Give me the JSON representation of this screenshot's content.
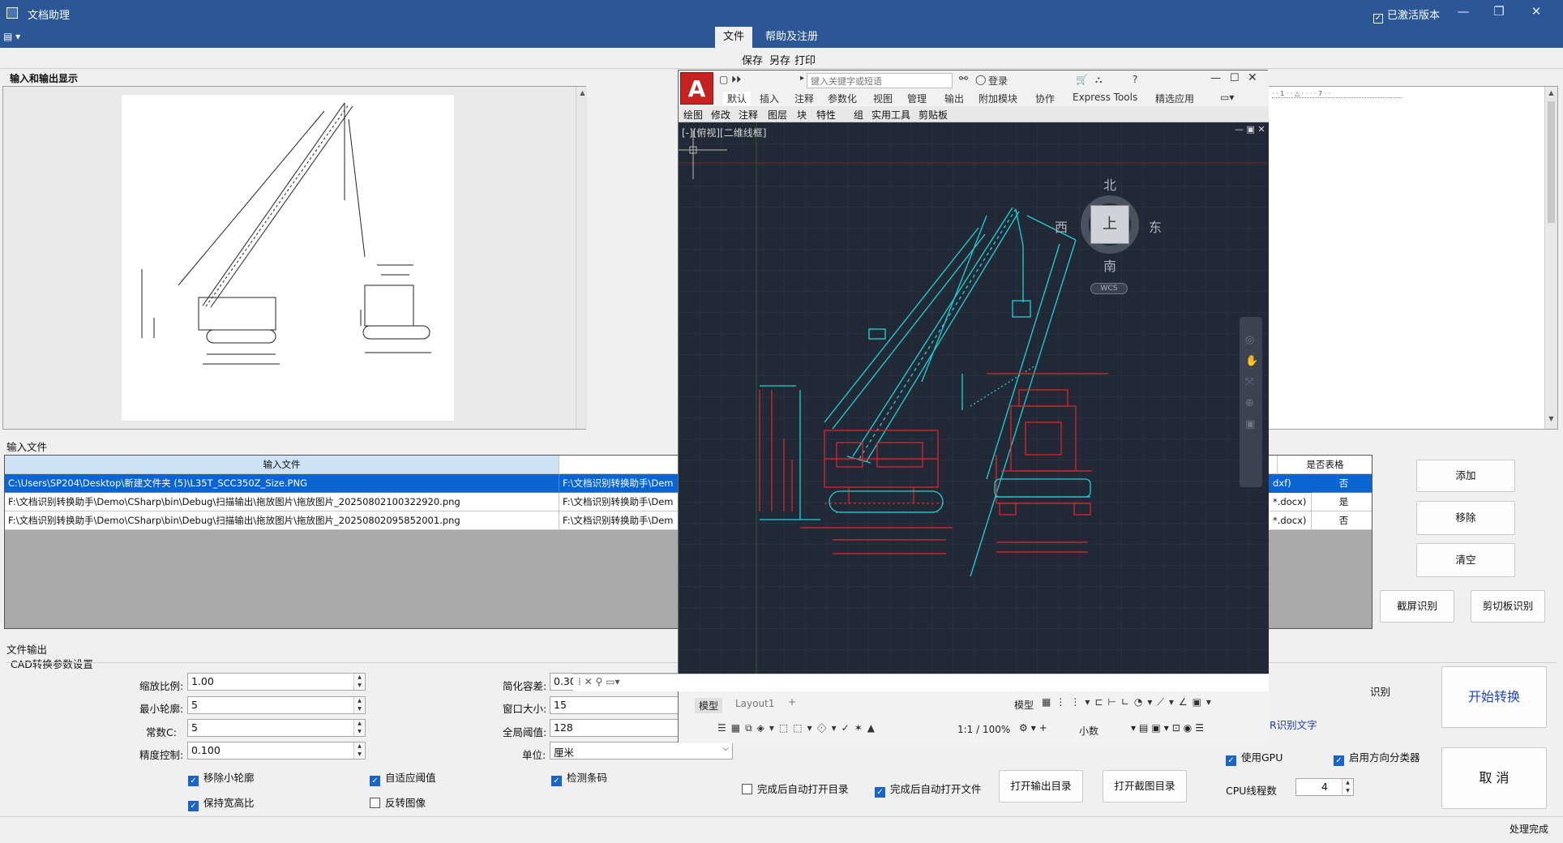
{
  "window": {
    "title": "文档助理",
    "activation": "已激活版本",
    "min": "—",
    "restore": "❐",
    "close": "✕"
  },
  "menu": {
    "tabs": [
      "文件",
      "帮助及注册"
    ],
    "sub_actions": [
      "保存",
      "另存",
      "打印"
    ]
  },
  "io_panel": {
    "title": "输入和输出显示"
  },
  "input_files": {
    "title": "输入文件",
    "columns": [
      "输入文件",
      "",
      "是否表格"
    ],
    "rows": [
      {
        "input": "C:\\Users\\SP204\\Desktop\\新建文件夹 (5)\\L35T_SCC350Z_Size.PNG",
        "output": "F:\\文档识别转换助手\\Dem",
        "ext": "dxf)",
        "is_table": "否"
      },
      {
        "input": "F:\\文档识别转换助手\\Demo\\CSharp\\bin\\Debug\\扫描输出\\拖放图片\\拖放图片_20250802100322920.png",
        "output": "F:\\文档识别转换助手\\Dem",
        "ext": "*.docx)",
        "is_table": "是"
      },
      {
        "input": "F:\\文档识别转换助手\\Demo\\CSharp\\bin\\Debug\\扫描输出\\拖放图片\\拖放图片_20250802095852001.png",
        "output": "F:\\文档识别转换助手\\Dem",
        "ext": "*.docx)",
        "is_table": "否"
      }
    ],
    "buttons": {
      "add": "添加",
      "remove": "移除",
      "clear": "清空",
      "screen_ocr": "截屏识别",
      "clipboard_ocr": "剪切板识别"
    }
  },
  "file_output": {
    "title": "文件输出",
    "cad_group": "CAD转换参数设置",
    "fields": {
      "scale_label": "缩放比例:",
      "scale": "1.00",
      "min_contour_label": "最小轮廓:",
      "min_contour": "5",
      "const_c_label": "常数C:",
      "const_c": "5",
      "precision_label": "精度控制:",
      "precision": "0.100",
      "simplify_label": "简化容差:",
      "simplify": "0.30",
      "window_label": "窗口大小:",
      "window": "15",
      "global_label": "全局阈值:",
      "global": "128",
      "unit_label": "单位:",
      "unit": "厘米"
    },
    "checks": {
      "remove_small": "移除小轮廓",
      "adaptive": "自适应阈值",
      "detect_bars": "检测条码",
      "keep_ratio": "保持宽高比",
      "invert": "反转图像",
      "open_dir_after": "完成后自动打开目录",
      "open_file_after": "完成后自动打开文件",
      "use_gpu": "使用GPU",
      "dir_classifier": "启用方向分类器"
    },
    "buttons": {
      "open_out_dir": "打开输出目录",
      "open_shot_dir": "打开截图目录",
      "start": "开始转换",
      "cancel": "取 消"
    },
    "right_fragments": {
      "recognize": "识别",
      "ocr_text": "R识别文字"
    },
    "cpu_label": "CPU线程数",
    "cpu": "4"
  },
  "status": "处理完成",
  "acad": {
    "search_placeholder": "键入关键字或短语",
    "login": "登录",
    "tabs": [
      "默认",
      "插入",
      "注释",
      "参数化",
      "视图",
      "管理",
      "输出",
      "附加模块",
      "协作",
      "Express Tools",
      "精选应用"
    ],
    "panels": [
      "绘图",
      "修改",
      "注释",
      "图层",
      "块",
      "特性",
      "组",
      "实用工具",
      "剪贴板"
    ],
    "view_label": "[-][俯视][二维线框]",
    "compass": {
      "n": "北",
      "s": "南",
      "e": "东",
      "w": "西",
      "top": "上",
      "wcs": "WCS"
    },
    "layout_tabs": [
      "模型",
      "Layout1",
      "+"
    ],
    "model_btn": "模型",
    "scale": "1:1 / 100%",
    "decimal": "小数"
  },
  "colors": {
    "accent": "#2b5797",
    "cad_red": "#e8262a",
    "cad_cyan": "#1fd1d6"
  }
}
